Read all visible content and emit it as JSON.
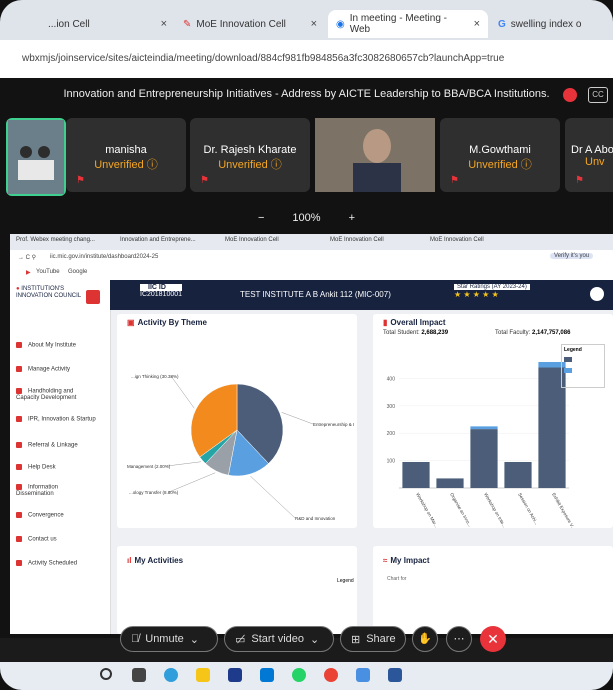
{
  "tabs": [
    {
      "label": "...ion Cell"
    },
    {
      "label": "MoE Innovation Cell"
    },
    {
      "label": "In meeting - Meeting - Web"
    },
    {
      "label": "swelling index o"
    }
  ],
  "address": "wbxmjs/joinservice/sites/aicteindia/meeting/download/884cf981fb984856a3fc3082680657cb?launchApp=true",
  "meeting": {
    "title": "Innovation and Entrepreneurship Initiatives - Address by AICTE Leadership to BBA/BCA Institutions.",
    "participants": [
      {
        "name": "manisha",
        "status": "Unverified ⓘ"
      },
      {
        "name": "Dr. Rajesh Kharate",
        "status": "Unverified ⓘ"
      },
      {
        "name": "M.Gowthami",
        "status": "Unverified ⓘ"
      },
      {
        "name": "Dr A Abo",
        "status": "Unv"
      }
    ],
    "zoom": "100%",
    "zoom_minus": "−",
    "zoom_plus": "+"
  },
  "shared": {
    "tabs": [
      "Prof. Webex meeting chang...",
      "Innovation and Entreprene...",
      "MoE Innovation Cell",
      "MoE Innovation Cell",
      "MoE Innovation Cell"
    ],
    "url": "iic.mic.gov.in/institute/dashboard2024-25",
    "bookmarks": [
      "YouTube",
      "Google"
    ],
    "profile": "Verify it's you",
    "iic_id_label": "IIC ID",
    "iic_id": "IC201810001",
    "institute": "TEST INSTITUTE A B Ankit 112 (MIC-007)",
    "star_label": "Star Ratings (AY 2023-24)",
    "stars": "★ ★ ★ ★ ★",
    "logo": "INSTITUTION'S INNOVATION COUNCIL",
    "sidebar": [
      "About My Institute",
      "Manage Activity",
      "Handholding and Capacity Development",
      "IPR, Innovation & Startup",
      "Referral & Linkage",
      "Help Desk",
      "Information Dissemination",
      "Convergence",
      "Contact us",
      "Activity Scheduled"
    ],
    "activity_title": "Activity By Theme",
    "impact_title": "Overall Impact",
    "total_student_label": "Total Student:",
    "total_student": "2,688,239",
    "total_faculty_label": "Total Faculty:",
    "total_faculty": "2,147,757,086",
    "legend_title": "Legend",
    "my_activities": "My Activities",
    "my_impact": "My Impact",
    "chart_for": "Chart for",
    "legend_small": "Legend"
  },
  "controls": {
    "unmute": "Unmute",
    "video": "Start video",
    "share": "Share"
  },
  "chart_data": [
    {
      "type": "pie",
      "title": "Activity By Theme",
      "labels": [
        "Entrepreneurship & I",
        "R&D and Innovation",
        "...ology Transfer (8.80%)",
        "Management (2.00%)",
        "...ign Thinking (30.38%)"
      ],
      "values": [
        38,
        15,
        9,
        3,
        35
      ],
      "colors": [
        "#4b5d78",
        "#5aa0e0",
        "#9aa0a8",
        "#25a5a5",
        "#f28a1e"
      ]
    },
    {
      "type": "bar",
      "title": "Overall Impact",
      "categories": [
        "Workshop on Mar...",
        "Organise an Inno...",
        "Workshop on Inte...",
        "Session on Achi...",
        "Exhibit Exposure V..."
      ],
      "series": [
        {
          "values": [
            95,
            35,
            215,
            95,
            440
          ],
          "color": "#4b5d78"
        },
        {
          "values": [
            0,
            0,
            10,
            0,
            20
          ],
          "color": "#5aa0e0"
        }
      ],
      "yticks": [
        100,
        200,
        300,
        400
      ],
      "ylim": [
        0,
        460
      ]
    }
  ]
}
